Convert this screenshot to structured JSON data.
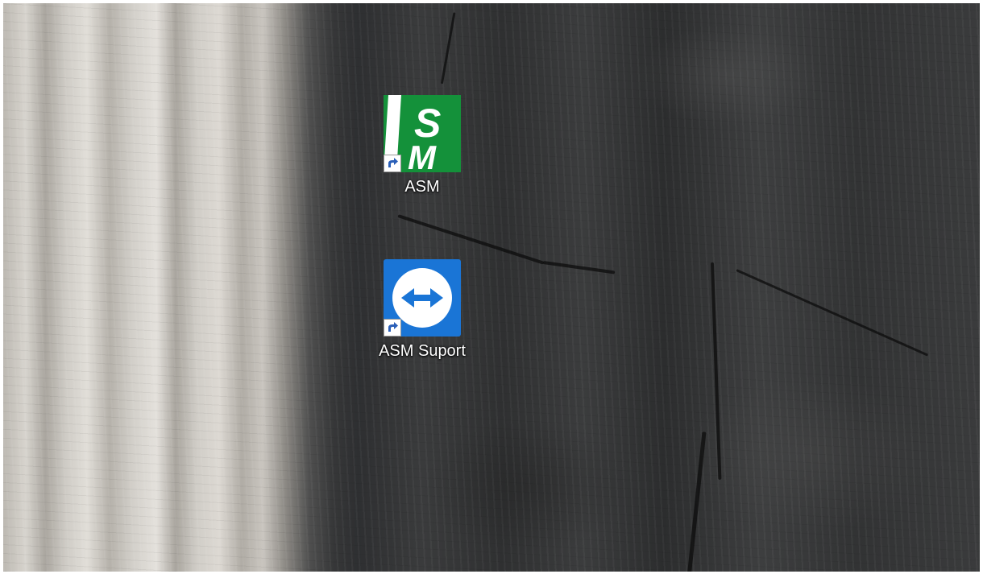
{
  "desktop": {
    "icons": [
      {
        "label": "ASM",
        "icon": "asm-app-icon",
        "shortcut": true,
        "brand_color": "#14913a"
      },
      {
        "label": "ASM Suport",
        "icon": "teamviewer-icon",
        "shortcut": true,
        "brand_color": "#1a75d6"
      }
    ]
  }
}
